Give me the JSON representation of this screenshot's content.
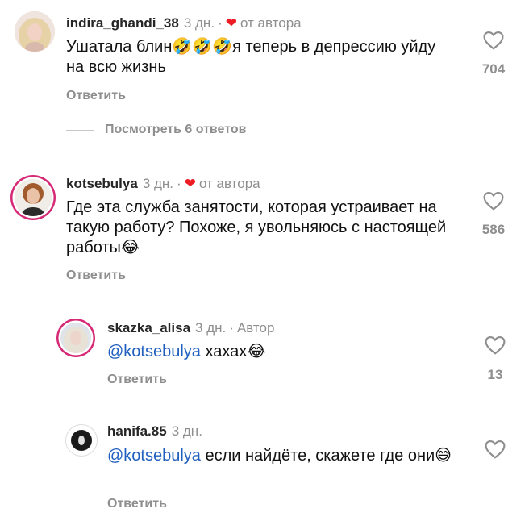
{
  "comments": [
    {
      "username": "indira_ghandi_38",
      "time": "3 дн.",
      "separator": "·",
      "role": "от автора",
      "text": "Ушатала блин🤣🤣🤣я теперь в депрессию уйду на всю жизнь",
      "reply": "Ответить",
      "likes": "704",
      "avatar_icon": "woman-blonde-avatar"
    },
    {
      "username": "kotsebulya",
      "time": "3 дн.",
      "separator": "·",
      "role": "от автора",
      "text": "Где эта служба занятости, которая устраивает на такую работу? Похоже, я увольняюсь с настоящей работы😂",
      "reply": "Ответить",
      "likes": "586",
      "avatar_icon": "woman-portrait-avatar"
    }
  ],
  "view_replies": "Посмотреть 6 ответов",
  "replies": [
    {
      "username": "skazka_alisa",
      "time": "3 дн.",
      "separator": "·",
      "role": "Автор",
      "mention": "@kotsebulya",
      "text": " хахах😂",
      "reply": "Ответить",
      "likes": "13"
    },
    {
      "username": "hanifa.85",
      "time": "3 дн.",
      "mention": "@kotsebulya",
      "text": " если найдёте, скажете где они😅",
      "reply": "Ответить",
      "likes": ""
    }
  ],
  "colors": {
    "heart": "#ed1c24",
    "muted": "#8e8e8e",
    "mention": "#1f5fbf",
    "story_ring": "#d62976"
  }
}
